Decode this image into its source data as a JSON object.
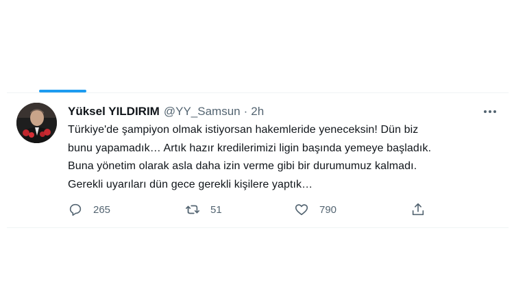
{
  "tweet": {
    "author_name": "Yüksel YILDIRIM",
    "handle": "@YY_Samsun",
    "separator": "·",
    "time": "2h",
    "text": "Türkiye'de şampiyon olmak istiyorsan hakemleride yeneceksin! Dün biz\nbunu yapamadık… Artık hazır kredilerimizi ligin başında yemeye başladık.\nBuna yönetim olarak asla daha izin verme gibi bir durumumuz kalmadı.\nGerekli uyarıları dün gece gerekli kişilere yaptık…",
    "stats": {
      "replies": "265",
      "retweets": "51",
      "likes": "790"
    }
  },
  "icons": {
    "more": "more-icon",
    "reply": "reply-icon",
    "retweet": "retweet-icon",
    "like": "heart-icon",
    "share": "share-icon"
  },
  "colors": {
    "accent": "#1d9bf0",
    "text": "#0f1419",
    "secondary": "#536471",
    "divider": "#eff3f4"
  }
}
